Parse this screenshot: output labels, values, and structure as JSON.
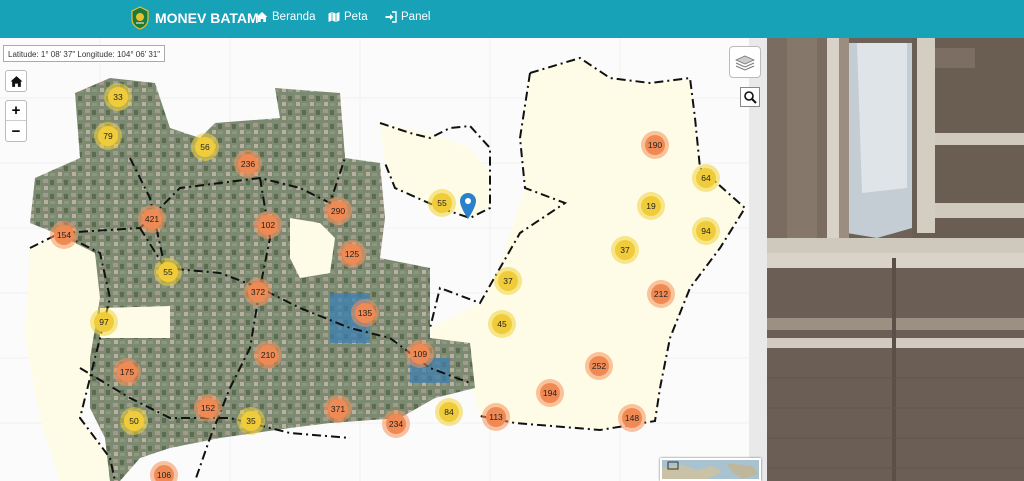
{
  "navbar": {
    "brand": "MONEV BATAM",
    "items": [
      {
        "label": "Beranda",
        "icon": "home-icon"
      },
      {
        "label": "Peta",
        "icon": "map-icon"
      },
      {
        "label": "Panel",
        "icon": "sign-in-icon"
      }
    ],
    "color": "#17a2b8"
  },
  "map": {
    "coordinates": "Latitude: 1° 08' 37\" Longitude: 104° 06' 31\"",
    "zoom_in": "+",
    "zoom_out": "−",
    "clusters": [
      {
        "count": "33",
        "color": "yellow"
      },
      {
        "count": "79",
        "color": "yellow"
      },
      {
        "count": "56",
        "color": "yellow"
      },
      {
        "count": "236",
        "color": "orange"
      },
      {
        "count": "421",
        "color": "orange"
      },
      {
        "count": "102",
        "color": "orange"
      },
      {
        "count": "290",
        "color": "orange"
      },
      {
        "count": "154",
        "color": "orange"
      },
      {
        "count": "55",
        "color": "yellow"
      },
      {
        "count": "125",
        "color": "orange"
      },
      {
        "count": "372",
        "color": "orange"
      },
      {
        "count": "97",
        "color": "yellow"
      },
      {
        "count": "135",
        "color": "orange"
      },
      {
        "count": "210",
        "color": "orange"
      },
      {
        "count": "109",
        "color": "orange"
      },
      {
        "count": "175",
        "color": "orange"
      },
      {
        "count": "152",
        "color": "orange"
      },
      {
        "count": "35",
        "color": "yellow"
      },
      {
        "count": "371",
        "color": "orange"
      },
      {
        "count": "234",
        "color": "orange"
      },
      {
        "count": "84",
        "color": "yellow"
      },
      {
        "count": "50",
        "color": "yellow"
      },
      {
        "count": "106",
        "color": "orange"
      },
      {
        "count": "55",
        "color": "yellow"
      },
      {
        "count": "37",
        "color": "yellow"
      },
      {
        "count": "45",
        "color": "yellow"
      },
      {
        "count": "113",
        "color": "orange"
      },
      {
        "count": "194",
        "color": "orange"
      },
      {
        "count": "252",
        "color": "orange"
      },
      {
        "count": "148",
        "color": "orange"
      },
      {
        "count": "212",
        "color": "orange"
      },
      {
        "count": "37",
        "color": "yellow"
      },
      {
        "count": "94",
        "color": "yellow"
      },
      {
        "count": "19",
        "color": "yellow"
      },
      {
        "count": "64",
        "color": "yellow"
      },
      {
        "count": "190",
        "color": "orange"
      }
    ]
  }
}
